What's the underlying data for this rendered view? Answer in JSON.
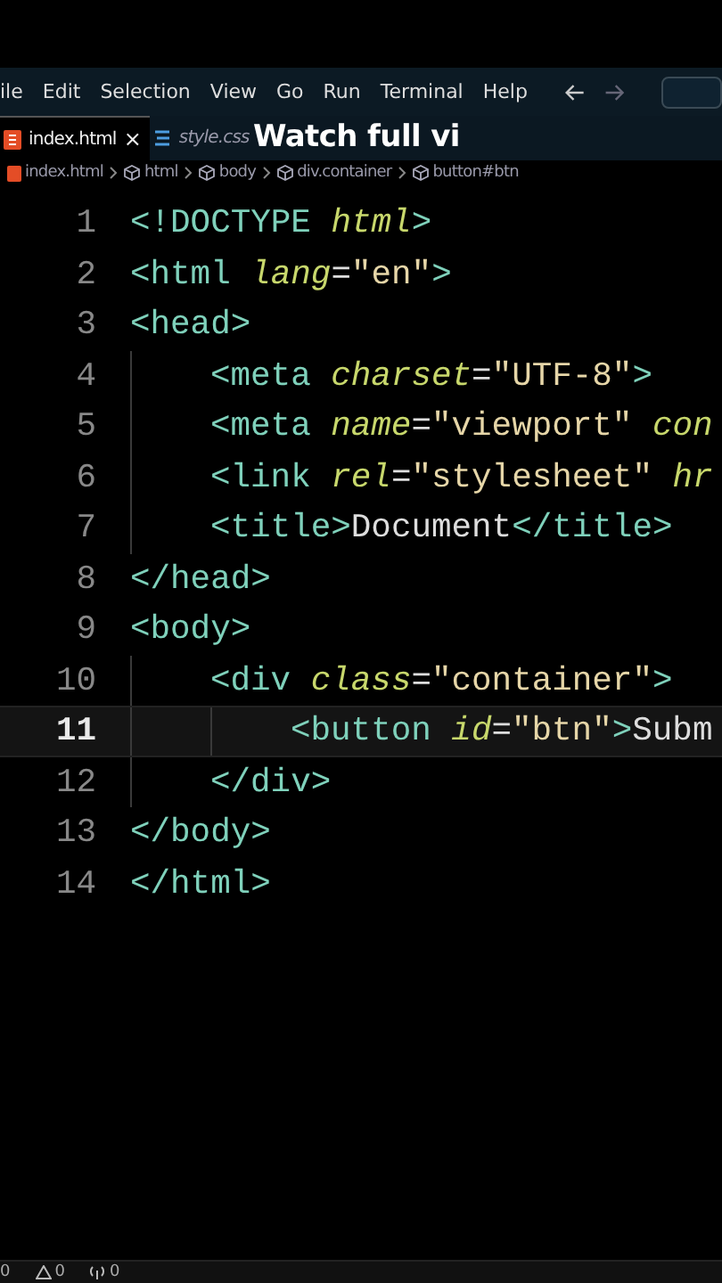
{
  "menu_bar": {
    "items": [
      "ile",
      "Edit",
      "Selection",
      "View",
      "Go",
      "Run",
      "Terminal",
      "Help"
    ]
  },
  "tabs": [
    {
      "label": "index.html",
      "kind": "html",
      "selected": true,
      "close": "×"
    },
    {
      "label": "style.css",
      "kind": "css",
      "selected": false
    }
  ],
  "caption": "Watch full vi",
  "breadcrumb": [
    {
      "label": "index.html",
      "kind": "file"
    },
    {
      "label": "html",
      "kind": "element"
    },
    {
      "label": "body",
      "kind": "element"
    },
    {
      "label": "div.container",
      "kind": "element"
    },
    {
      "label": "button#btn",
      "kind": "element"
    }
  ],
  "editor": {
    "lines": [
      {
        "number": "1",
        "selected": false,
        "tokens": [
          {
            "kind": "tag",
            "text": "<!DOCTYPE "
          },
          {
            "kind": "attr",
            "text": "html"
          },
          {
            "kind": "tag",
            "text": ">"
          }
        ]
      },
      {
        "number": "2",
        "selected": false,
        "tokens": [
          {
            "kind": "tag",
            "text": "<html "
          },
          {
            "kind": "attr",
            "text": "lang"
          },
          {
            "kind": "text",
            "text": "="
          },
          {
            "kind": "string",
            "text": "\"en\""
          },
          {
            "kind": "tag",
            "text": ">"
          }
        ]
      },
      {
        "number": "3",
        "selected": false,
        "tokens": [
          {
            "kind": "tag",
            "text": "<head>"
          }
        ],
        "children": [
          {
            "number": "4",
            "selected": false,
            "tokens": [
              {
                "kind": "tag",
                "text": "<meta "
              },
              {
                "kind": "attr",
                "text": "charset"
              },
              {
                "kind": "text",
                "text": "="
              },
              {
                "kind": "string",
                "text": "\"UTF-8\""
              },
              {
                "kind": "tag",
                "text": ">"
              }
            ]
          },
          {
            "number": "5",
            "selected": false,
            "tokens": [
              {
                "kind": "tag",
                "text": "<meta "
              },
              {
                "kind": "attr",
                "text": "name"
              },
              {
                "kind": "text",
                "text": "="
              },
              {
                "kind": "string",
                "text": "\"viewport\" "
              },
              {
                "kind": "attr",
                "text": "con"
              }
            ]
          },
          {
            "number": "6",
            "selected": false,
            "tokens": [
              {
                "kind": "tag",
                "text": "<link "
              },
              {
                "kind": "attr",
                "text": "rel"
              },
              {
                "kind": "text",
                "text": "="
              },
              {
                "kind": "string",
                "text": "\"stylesheet\" "
              },
              {
                "kind": "attr",
                "text": "hr"
              }
            ]
          },
          {
            "number": "7",
            "selected": false,
            "tokens": [
              {
                "kind": "tag",
                "text": "<title>"
              },
              {
                "kind": "text",
                "text": "Document"
              },
              {
                "kind": "tag",
                "text": "</title>"
              }
            ]
          }
        ]
      },
      {
        "number": "8",
        "selected": false,
        "tokens": [
          {
            "kind": "tag",
            "text": "</head>"
          }
        ]
      },
      {
        "number": "9",
        "selected": false,
        "tokens": [
          {
            "kind": "tag",
            "text": "<body>"
          }
        ],
        "children": [
          {
            "number": "10",
            "selected": false,
            "tokens": [
              {
                "kind": "tag",
                "text": "<div "
              },
              {
                "kind": "attr",
                "text": "class"
              },
              {
                "kind": "text",
                "text": "="
              },
              {
                "kind": "string",
                "text": "\"container\""
              },
              {
                "kind": "tag",
                "text": ">"
              }
            ],
            "children": [
              {
                "number": "11",
                "selected": true,
                "tokens": [
                  {
                    "kind": "tag",
                    "text": "<button "
                  },
                  {
                    "kind": "attr",
                    "text": "id"
                  },
                  {
                    "kind": "text",
                    "text": "="
                  },
                  {
                    "kind": "string",
                    "text": "\"btn\""
                  },
                  {
                    "kind": "tag",
                    "text": ">"
                  },
                  {
                    "kind": "text",
                    "text": "Subm"
                  }
                ]
              }
            ]
          },
          {
            "number": "12",
            "selected": false,
            "tokens": [
              {
                "kind": "tag",
                "text": "</div>"
              }
            ]
          }
        ]
      },
      {
        "number": "13",
        "selected": false,
        "tokens": [
          {
            "kind": "tag",
            "text": "</body>"
          }
        ]
      },
      {
        "number": "14",
        "selected": false,
        "tokens": [
          {
            "kind": "tag",
            "text": "</html>"
          }
        ]
      }
    ]
  },
  "status_bar": {
    "items": [
      {
        "kind": "errors",
        "count": "0"
      },
      {
        "kind": "warnings",
        "count": "0"
      },
      {
        "kind": "ports",
        "count": "0"
      }
    ]
  }
}
